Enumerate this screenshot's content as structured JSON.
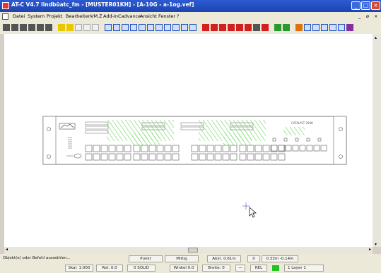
{
  "window": {
    "title": "AT-C V4.7   lindbüatc_fm - [MUSTER01KH] - [A-10G - a-1og.vef]",
    "buttons": [
      "_",
      "□",
      "×"
    ]
  },
  "menu": {
    "items": [
      "Datei",
      "System",
      "Projekt",
      "Bearbeiten",
      "VM.Z",
      "Add-In",
      "Cadvance",
      "Ansicht",
      "Fenster",
      "?"
    ],
    "mdi_buttons": [
      "_",
      "ø",
      "×"
    ]
  },
  "toolbar": {
    "icons": [
      "new-icon",
      "open-icon",
      "save-icon",
      "print-icon",
      "preview-icon",
      "zoom-icon",
      "yellow-tool-icon",
      "yellow-tool-icon",
      "arrow-icon",
      "circle-icon",
      "rect-icon",
      "layer-icon",
      "layer-icon",
      "layer-icon",
      "grid-icon",
      "grid-icon",
      "grid-icon",
      "grid-icon",
      "grid-icon",
      "grid-icon",
      "grid-icon",
      "grid-icon",
      "red-tool-icon",
      "red-tool-icon",
      "red-tool-icon",
      "red-tool-icon",
      "red-tool-icon",
      "red-tool-icon",
      "text-icon",
      "red-tool-icon",
      "green-tool-icon",
      "green-tool-icon",
      "orange-tool-icon",
      "snap-icon",
      "snap-icon",
      "snap-icon",
      "snap-icon",
      "snap-icon",
      "purple-tool-icon"
    ],
    "colors": {
      "red": "#d22020",
      "green": "#2a9a2a",
      "yellow": "#e8c800",
      "blue": "#2050c0",
      "orange": "#e07010",
      "purple": "#8030a0"
    }
  },
  "drawing": {
    "panel_label": "CATALYST 2948"
  },
  "status": {
    "prompt": "Objekt(e) oder Befehl auswählen...",
    "snap": "Punkt",
    "mode": "Mittig",
    "distance": "Abst. 0.61m",
    "value": "0",
    "coords": "0.33m  -0.14m",
    "scale": "Skal. 1:000",
    "rot": "Rot. 0.0",
    "solid": "0 SOLID",
    "angle": "Winkel 0.0",
    "width": "Breite: 0",
    "dash": "—",
    "rel": "REL",
    "layer": "1 Layer 1"
  }
}
